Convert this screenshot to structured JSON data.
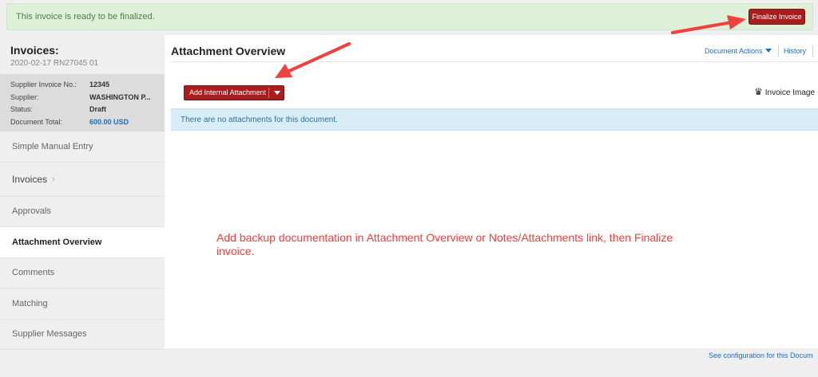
{
  "banner": {
    "message": "This invoice is ready to be finalized.",
    "finalize_label": "Finalize Invoice"
  },
  "sidebar": {
    "title": "Invoices:",
    "subtitle": "2020-02-17 RN27045 01",
    "details": [
      {
        "label": "Supplier Invoice No.:",
        "value": "12345"
      },
      {
        "label": "Supplier:",
        "value": "WASHINGTON P..."
      },
      {
        "label": "Status:",
        "value": "Draft"
      },
      {
        "label": "Document Total:",
        "value": "600.00  USD"
      }
    ],
    "nav": [
      {
        "label": "Simple Manual Entry"
      },
      {
        "label": "Invoices"
      },
      {
        "label": "Approvals"
      },
      {
        "label": "Attachment Overview"
      },
      {
        "label": "Comments"
      },
      {
        "label": "Matching"
      },
      {
        "label": "Supplier Messages"
      }
    ]
  },
  "main": {
    "title": "Attachment Overview",
    "document_actions": "Document Actions",
    "history": "History",
    "add_attachment": "Add Internal Attachment",
    "invoice_image": "Invoice Image",
    "empty_message": "There are no attachments for this document.",
    "annotation": "Add backup documentation in Attachment Overview or Notes/Attachments link, then Finalize invoice.",
    "footer_link": "See configuration for this Docum"
  },
  "colors": {
    "accent_red": "#a81e1e",
    "link_blue": "#1a6fc2",
    "annotation_red": "#f0403f",
    "success_bg": "#dff0d8",
    "info_bg": "#d9edf7"
  },
  "icons": [
    "crown-icon",
    "chevron-right-icon",
    "caret-down-icon",
    "annotation-arrow"
  ]
}
